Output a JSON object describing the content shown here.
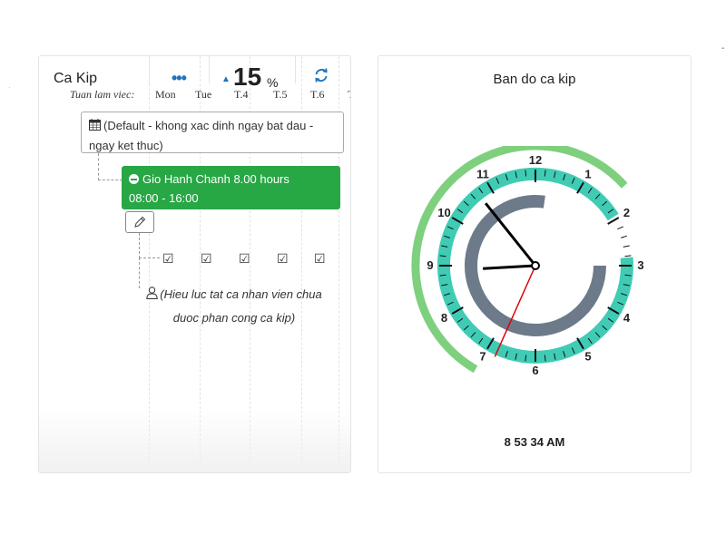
{
  "left_panel": {
    "title": "Ca Kip",
    "more_label": "•••",
    "percent_value": "15",
    "percent_unit": "%",
    "week_label": "Tuan lam viec:",
    "days": [
      "Mon",
      "Tue",
      "T.4",
      "T.5",
      "T.6",
      "T"
    ],
    "default_schedule": {
      "line1": "(Default - khong xac dinh ngay bat dau -",
      "line2": "ngay ket thuc)"
    },
    "shift": {
      "line1": "Gio Hanh Chanh 8.00 hours",
      "line2": "08:00 - 16:00",
      "color": "#28a745"
    },
    "checks": [
      "☑",
      "☑",
      "☑",
      "☑",
      "☑"
    ],
    "note": {
      "line1": "(Hieu luc tat ca nhan vien chua",
      "line2": "duoc phan cong ca kip)"
    }
  },
  "clock_panel": {
    "title": "Ban do ca kip",
    "hour_numbers": [
      "12",
      "1",
      "2",
      "3",
      "4",
      "5",
      "6",
      "7",
      "8",
      "9",
      "10",
      "11"
    ],
    "time": {
      "hours": 8,
      "minutes": 53,
      "seconds": 34
    },
    "digital_time": "8 53 34 AM",
    "colors": {
      "outer_arc": "#7ed07e",
      "dial_band": "#40cbb5",
      "inner_arc": "#6c7a89",
      "hands": "#000000",
      "second_hand": "#e0000a"
    }
  },
  "side_mark": "-"
}
